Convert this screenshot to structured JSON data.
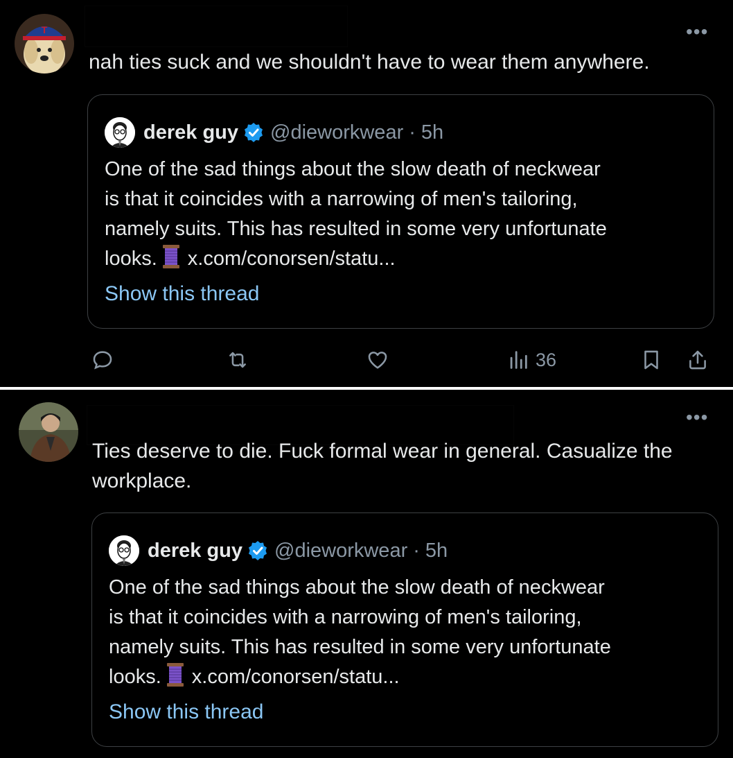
{
  "posts": [
    {
      "text": "nah ties suck and we shouldn't have to wear them anywhere.",
      "avatar_icon": "dog-with-cap-avatar",
      "quote": {
        "name": "derek guy",
        "handle": "@dieworkwear",
        "separator": "·",
        "time": "5h",
        "text_lines": [
          "One of the sad things about the slow death of neckwear",
          "is that it coincides with a narrowing of men's tailoring,",
          "namely suits. This has resulted in some very unfortunate"
        ],
        "last_line_start": "looks.",
        "link": "x.com/conorsen/statu...",
        "show_thread": "Show this thread"
      },
      "actions": {
        "views": "36"
      }
    },
    {
      "text": "Ties deserve to die. Fuck formal wear in general. Casualize the workplace.",
      "avatar_icon": "person-in-leather-jacket-avatar",
      "quote": {
        "name": "derek guy",
        "handle": "@dieworkwear",
        "separator": "·",
        "time": "5h",
        "text_lines": [
          "One of the sad things about the slow death of neckwear",
          "is that it coincides with a narrowing of men's tailoring,",
          "namely suits. This has resulted in some very unfortunate"
        ],
        "last_line_start": "looks.",
        "link": "x.com/conorsen/statu...",
        "show_thread": "Show this thread"
      }
    }
  ],
  "more_menu_glyph": "•••",
  "colors": {
    "background": "#000000",
    "text": "#e7e9ea",
    "secondary": "#8b98a5",
    "link": "#8bc7f5",
    "verified": "#1d9bf0",
    "border": "#3e4144"
  }
}
